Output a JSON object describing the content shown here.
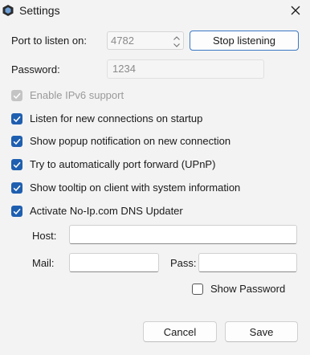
{
  "window": {
    "title": "Settings",
    "close_icon": "close-icon",
    "app_icon": "app-logo-icon"
  },
  "port": {
    "label": "Port to listen on:",
    "value": "4782"
  },
  "stop_button_label": "Stop listening",
  "password": {
    "label": "Password:",
    "value": "1234"
  },
  "options": [
    {
      "label": "Enable IPv6 support",
      "checked": true,
      "disabled": true
    },
    {
      "label": "Listen for new connections on startup",
      "checked": true,
      "disabled": false
    },
    {
      "label": "Show popup notification on new connection",
      "checked": true,
      "disabled": false
    },
    {
      "label": "Try to automatically port forward (UPnP)",
      "checked": true,
      "disabled": false
    },
    {
      "label": "Show tooltip on client with system information",
      "checked": true,
      "disabled": false
    },
    {
      "label": "Activate No-Ip.com DNS Updater",
      "checked": true,
      "disabled": false
    }
  ],
  "noip": {
    "host_label": "Host:",
    "host_value": "",
    "mail_label": "Mail:",
    "mail_value": "",
    "pass_label": "Pass:",
    "pass_value": "",
    "show_password_label": "Show Password",
    "show_password_checked": false
  },
  "cancel_label": "Cancel",
  "save_label": "Save",
  "colors": {
    "accent": "#1f5fb0",
    "background": "#f3f3f3"
  }
}
